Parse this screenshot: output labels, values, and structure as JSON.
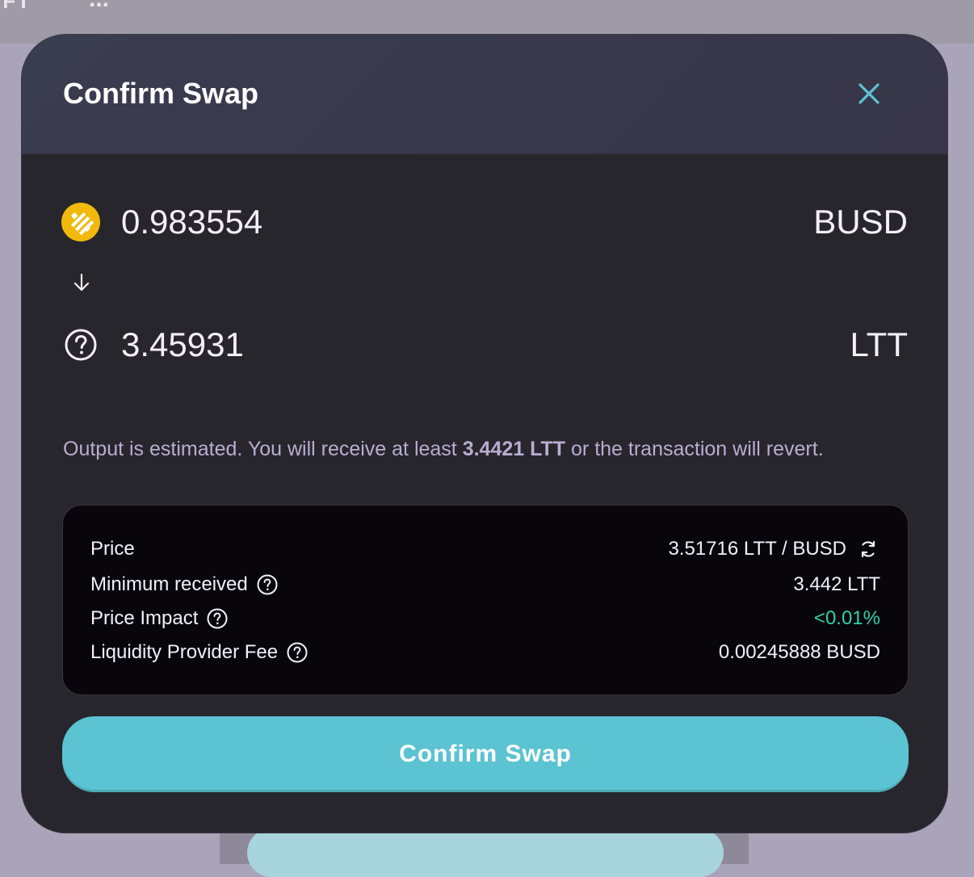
{
  "background": {
    "nav_text": "IFT",
    "more_dots": "..."
  },
  "modal": {
    "title": "Confirm Swap",
    "close_icon": "close-icon"
  },
  "swap": {
    "from": {
      "amount": "0.983554",
      "symbol": "BUSD",
      "icon": "busd-token-icon"
    },
    "to": {
      "amount": "3.45931",
      "symbol": "LTT",
      "icon": "unknown-token-icon"
    }
  },
  "estimate_note": {
    "prefix": "Output is estimated. You will receive at least ",
    "amount": "3.4421 LTT",
    "suffix": " or the transaction will revert."
  },
  "details": {
    "price_label": "Price",
    "price_value": "3.51716 LTT / BUSD",
    "min_received_label": "Minimum received",
    "min_received_value": "3.442 LTT",
    "price_impact_label": "Price Impact",
    "price_impact_value": "<0.01%",
    "lp_fee_label": "Liquidity Provider Fee",
    "lp_fee_value": "0.00245888 BUSD"
  },
  "confirm_button": "Confirm Swap",
  "colors": {
    "accent": "#5bc3d1",
    "close_icon": "#5bc3d1",
    "busd": "#f0b90b",
    "positive": "#31d0aa",
    "modal_bg": "#27262c",
    "details_bg": "#08060b",
    "text": "#f4eeff",
    "muted_text": "#b8add2"
  }
}
